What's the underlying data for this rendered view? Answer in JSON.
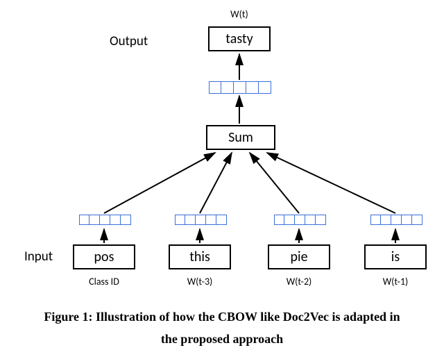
{
  "labels": {
    "output": "Output",
    "input": "Input",
    "wt": "W(t)"
  },
  "output_word": "tasty",
  "sum_label": "Sum",
  "inputs": [
    {
      "word": "pos",
      "wt": "Class ID"
    },
    {
      "word": "this",
      "wt": "W(t-3)"
    },
    {
      "word": "pie",
      "wt": "W(t-2)"
    },
    {
      "word": "is",
      "wt": "W(t-1)"
    }
  ],
  "caption_line1": "Figure 1: Illustration of how the CBOW like Doc2Vec is adapted in",
  "caption_line2": "the proposed approach",
  "vector_cells": 5
}
